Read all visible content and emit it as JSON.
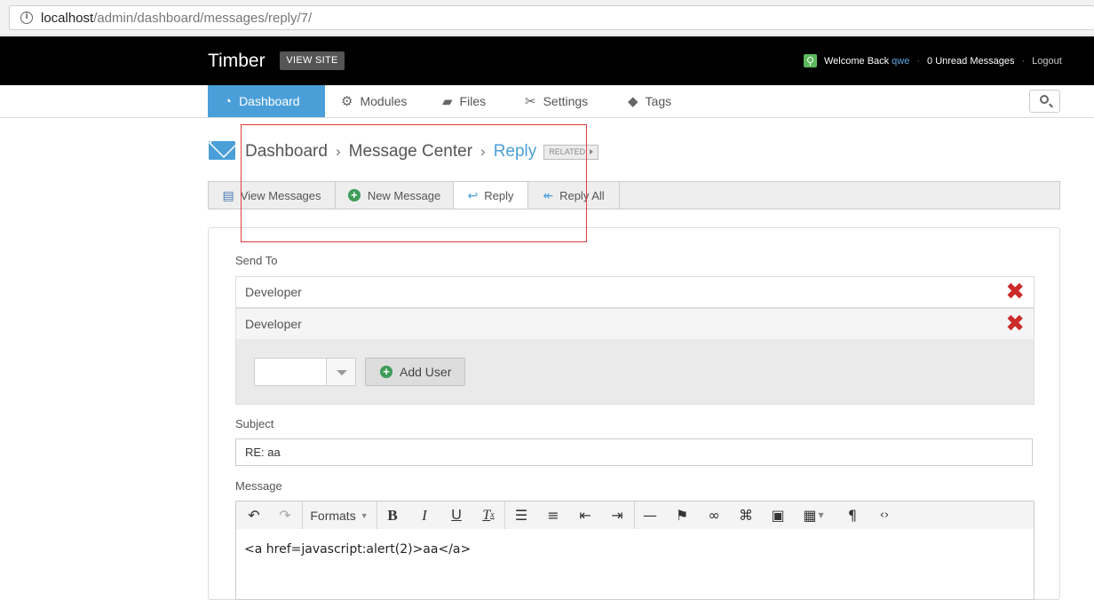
{
  "browser": {
    "url_host": "localhost",
    "url_path": "/admin/dashboard/messages/reply/7/"
  },
  "topbar": {
    "brand": "Timber",
    "view_site": "VIEW SITE",
    "welcome": "Welcome Back",
    "username": "qwe",
    "unread": "0 Unread Messages",
    "logout": "Logout"
  },
  "nav": {
    "items": [
      {
        "label": "Dashboard",
        "icon": "dashboard-icon"
      },
      {
        "label": "Modules",
        "icon": "gear-icon"
      },
      {
        "label": "Files",
        "icon": "folder-icon"
      },
      {
        "label": "Settings",
        "icon": "wrench-icon"
      },
      {
        "label": "Tags",
        "icon": "tag-icon"
      }
    ]
  },
  "breadcrumb": {
    "items": [
      "Dashboard",
      "Message Center",
      "Reply"
    ],
    "related": "RELATED"
  },
  "toolbar": {
    "buttons": [
      "View Messages",
      "New Message",
      "Reply",
      "Reply All"
    ]
  },
  "form": {
    "send_to_label": "Send To",
    "recipients": [
      "Developer",
      "Developer"
    ],
    "select_value": "",
    "add_user": "Add User",
    "subject_label": "Subject",
    "subject_value": "RE: aa",
    "message_label": "Message",
    "formats_label": "Formats",
    "message_content": "<a href=javascript:alert(2)>aa</a>"
  },
  "colors": {
    "accent": "#4a9fd8",
    "remove": "#cc2b2b",
    "add": "#3d9c58",
    "annotation": "#e23b3b"
  }
}
